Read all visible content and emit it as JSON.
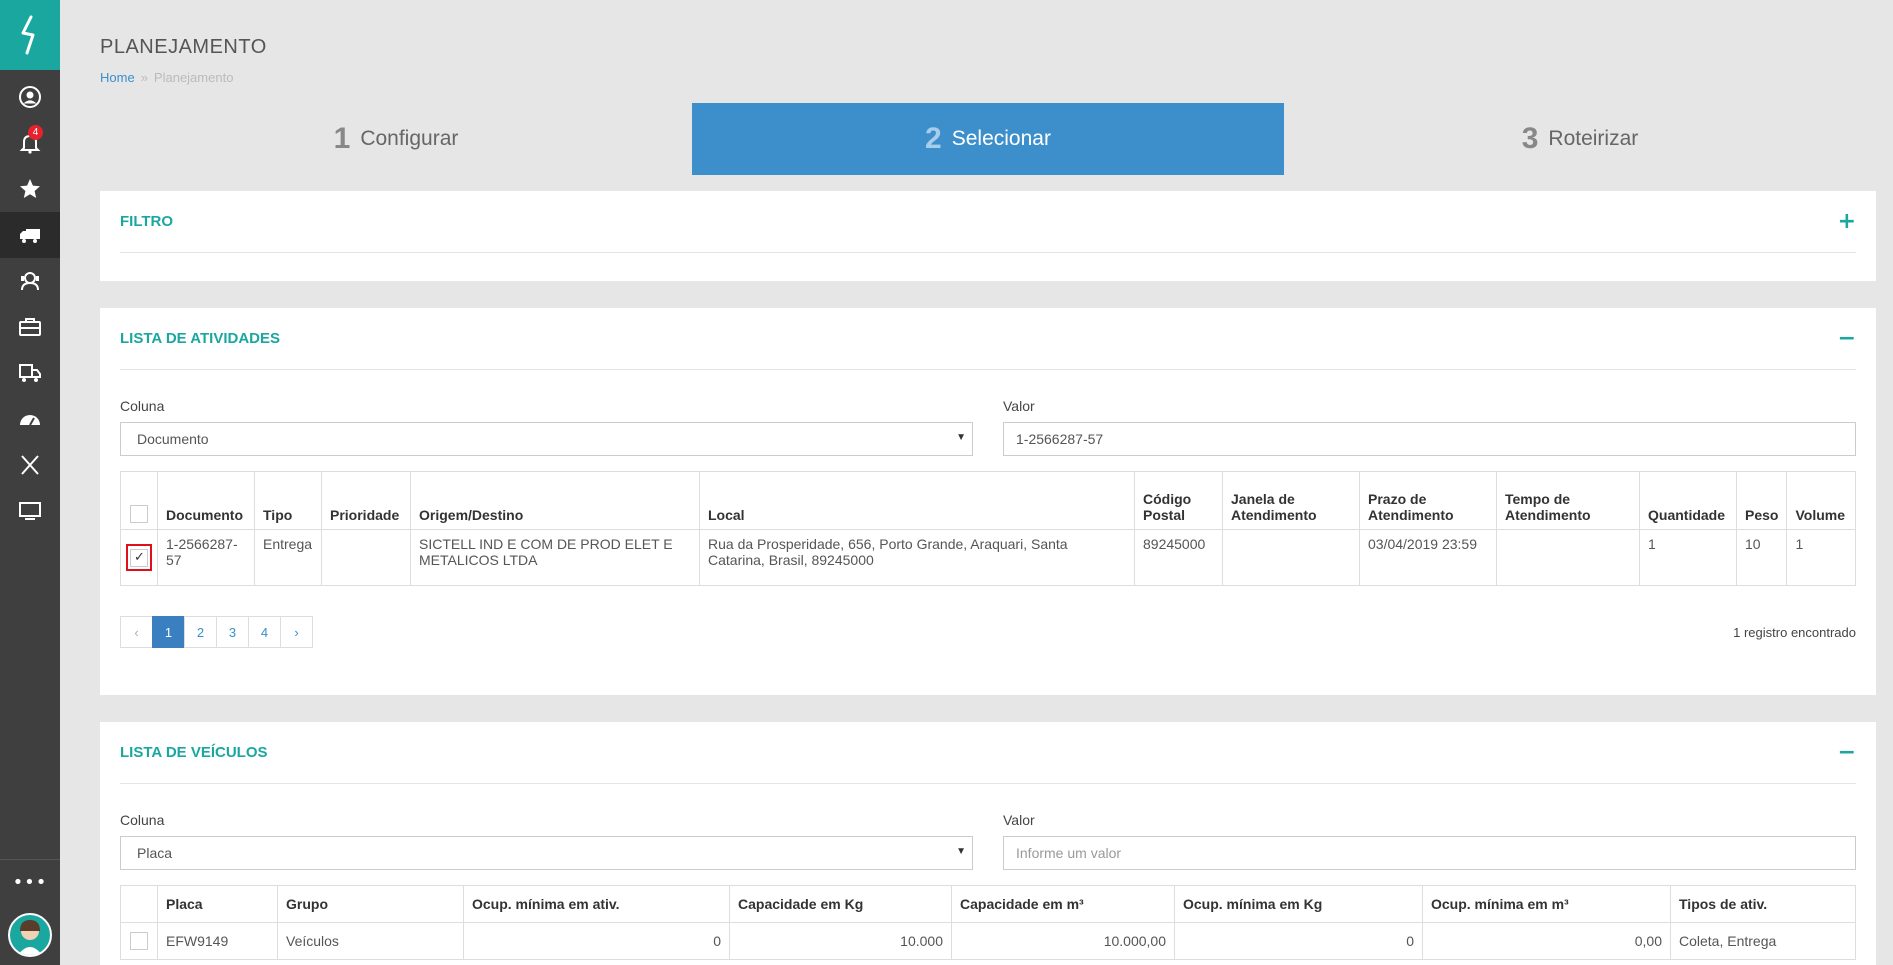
{
  "sidebar": {
    "logo": "logo-icon",
    "items": [
      {
        "name": "user-icon"
      },
      {
        "name": "bell-icon",
        "badge": "4"
      },
      {
        "name": "star-icon"
      },
      {
        "name": "truck-icon",
        "active": true
      },
      {
        "name": "support-icon"
      },
      {
        "name": "briefcase-icon"
      },
      {
        "name": "delivery-icon"
      },
      {
        "name": "dashboard-icon"
      },
      {
        "name": "x-icon"
      },
      {
        "name": "monitor-icon"
      }
    ],
    "more": "•••"
  },
  "header": {
    "title": "PLANEJAMENTO",
    "breadcrumb_home": "Home",
    "breadcrumb_sep": "»",
    "breadcrumb_current": "Planejamento"
  },
  "steps": [
    {
      "num": "1",
      "label": "Configurar"
    },
    {
      "num": "2",
      "label": "Selecionar"
    },
    {
      "num": "3",
      "label": "Roteirizar"
    }
  ],
  "filter": {
    "title": "FILTRO",
    "toggle": "+"
  },
  "atividades": {
    "title": "LISTA DE ATIVIDADES",
    "toggle": "−",
    "col_label": "Coluna",
    "col_value": "Documento",
    "val_label": "Valor",
    "val_value": "1-2566287-57",
    "headers": [
      "Documento",
      "Tipo",
      "Prioridade",
      "Origem/Destino",
      "Local",
      "Código Postal",
      "Janela de Atendimento",
      "Prazo de Atendimento",
      "Tempo de Atendimento",
      "Quantidade",
      "Peso",
      "Volume"
    ],
    "row": {
      "documento": "1-2566287-57",
      "tipo": "Entrega",
      "prioridade": "",
      "origem": "SICTELL IND E COM DE PROD ELET E METALICOS LTDA",
      "local": "Rua da Prosperidade, 656, Porto Grande, Araquari, Santa Catarina, Brasil, 89245000",
      "cep": "89245000",
      "janela": "",
      "prazo": "03/04/2019 23:59",
      "tempo": "",
      "quantidade": "1",
      "peso": "10",
      "volume": "1"
    },
    "pages": [
      "‹",
      "1",
      "2",
      "3",
      "4",
      "›"
    ],
    "records": "1 registro encontrado"
  },
  "veiculos": {
    "title": "LISTA DE VEÍCULOS",
    "toggle": "−",
    "col_label": "Coluna",
    "col_value": "Placa",
    "val_label": "Valor",
    "val_placeholder": "Informe um valor",
    "headers": [
      "Placa",
      "Grupo",
      "Ocup. mínima em ativ.",
      "Capacidade em Kg",
      "Capacidade em m³",
      "Ocup. mínima em Kg",
      "Ocup. mínima em m³",
      "Tipos de ativ."
    ],
    "row": {
      "placa": "EFW9149",
      "grupo": "Veículos",
      "ocup_ativ": "0",
      "cap_kg": "10.000",
      "cap_m3": "10.000,00",
      "ocup_kg": "0",
      "ocup_m3": "0,00",
      "tipos": "Coleta, Entrega"
    }
  }
}
